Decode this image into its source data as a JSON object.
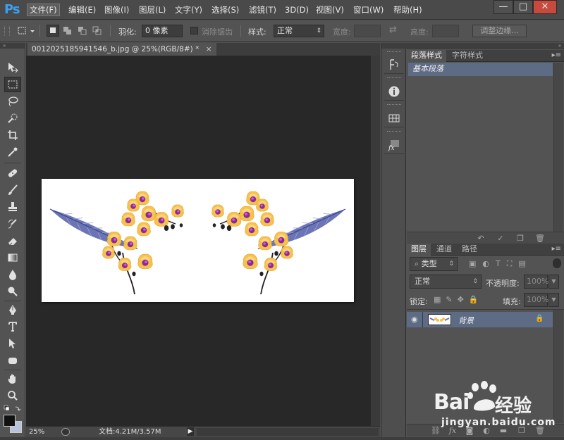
{
  "app": {
    "logo": "Ps",
    "menus": [
      "文件(F)",
      "编辑(E)",
      "图像(I)",
      "图层(L)",
      "文字(Y)",
      "选择(S)",
      "滤镜(T)",
      "3D(D)",
      "视图(V)",
      "窗口(W)",
      "帮助(H)"
    ],
    "window_buttons": [
      "—",
      "□",
      "✕"
    ]
  },
  "options_bar": {
    "feather_label": "羽化:",
    "feather_value": "0 像素",
    "antialias_label": "消除锯齿",
    "style_label": "样式:",
    "style_value": "正常",
    "width_label": "宽度:",
    "height_label": "高度:",
    "refine_edge_button": "调整边缘..."
  },
  "document": {
    "tab_title": "0012025185941546_b.jpg @ 25%(RGB/8#) *",
    "tab_close": "×",
    "zoom": "25%",
    "doc_info": "文档:4.21M/3.57M"
  },
  "paragraph_panel": {
    "tabs": [
      "段落样式",
      "字符样式"
    ],
    "items": [
      "基本段落"
    ]
  },
  "layers_panel": {
    "tabs": [
      "图层",
      "通道",
      "路径"
    ],
    "filter_type": "类型",
    "blend_mode": "正常",
    "opacity_label": "不透明度:",
    "opacity_value": "100%",
    "lock_label": "锁定:",
    "fill_label": "填充:",
    "fill_value": "100%",
    "layers": [
      {
        "name": "背景",
        "visible": true,
        "locked": true
      }
    ]
  },
  "watermark": {
    "brand_left": "Bai",
    "brand_right": "经验",
    "url": "jingyan.baidu.com"
  },
  "colors": {
    "selection_blue": "#5d6b85",
    "feather_blue": "#6b74b4",
    "orchid_yellow": "#f6c24e",
    "orchid_purple": "#8a2a98"
  }
}
